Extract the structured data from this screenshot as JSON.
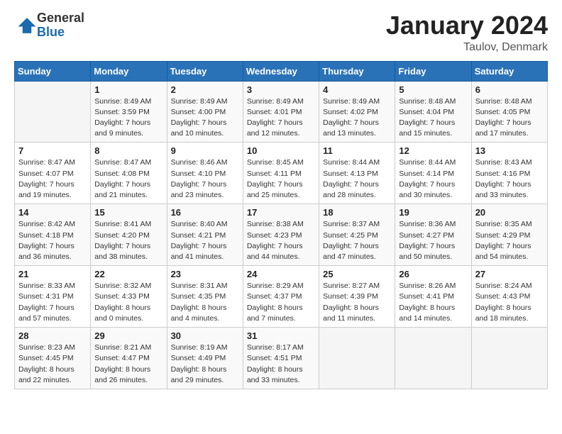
{
  "header": {
    "logo_general": "General",
    "logo_blue": "Blue",
    "title": "January 2024",
    "subtitle": "Taulov, Denmark"
  },
  "days_of_week": [
    "Sunday",
    "Monday",
    "Tuesday",
    "Wednesday",
    "Thursday",
    "Friday",
    "Saturday"
  ],
  "weeks": [
    [
      {
        "day": "",
        "info": ""
      },
      {
        "day": "1",
        "info": "Sunrise: 8:49 AM\nSunset: 3:59 PM\nDaylight: 7 hours\nand 9 minutes."
      },
      {
        "day": "2",
        "info": "Sunrise: 8:49 AM\nSunset: 4:00 PM\nDaylight: 7 hours\nand 10 minutes."
      },
      {
        "day": "3",
        "info": "Sunrise: 8:49 AM\nSunset: 4:01 PM\nDaylight: 7 hours\nand 12 minutes."
      },
      {
        "day": "4",
        "info": "Sunrise: 8:49 AM\nSunset: 4:02 PM\nDaylight: 7 hours\nand 13 minutes."
      },
      {
        "day": "5",
        "info": "Sunrise: 8:48 AM\nSunset: 4:04 PM\nDaylight: 7 hours\nand 15 minutes."
      },
      {
        "day": "6",
        "info": "Sunrise: 8:48 AM\nSunset: 4:05 PM\nDaylight: 7 hours\nand 17 minutes."
      }
    ],
    [
      {
        "day": "7",
        "info": "Sunrise: 8:47 AM\nSunset: 4:07 PM\nDaylight: 7 hours\nand 19 minutes."
      },
      {
        "day": "8",
        "info": "Sunrise: 8:47 AM\nSunset: 4:08 PM\nDaylight: 7 hours\nand 21 minutes."
      },
      {
        "day": "9",
        "info": "Sunrise: 8:46 AM\nSunset: 4:10 PM\nDaylight: 7 hours\nand 23 minutes."
      },
      {
        "day": "10",
        "info": "Sunrise: 8:45 AM\nSunset: 4:11 PM\nDaylight: 7 hours\nand 25 minutes."
      },
      {
        "day": "11",
        "info": "Sunrise: 8:44 AM\nSunset: 4:13 PM\nDaylight: 7 hours\nand 28 minutes."
      },
      {
        "day": "12",
        "info": "Sunrise: 8:44 AM\nSunset: 4:14 PM\nDaylight: 7 hours\nand 30 minutes."
      },
      {
        "day": "13",
        "info": "Sunrise: 8:43 AM\nSunset: 4:16 PM\nDaylight: 7 hours\nand 33 minutes."
      }
    ],
    [
      {
        "day": "14",
        "info": "Sunrise: 8:42 AM\nSunset: 4:18 PM\nDaylight: 7 hours\nand 36 minutes."
      },
      {
        "day": "15",
        "info": "Sunrise: 8:41 AM\nSunset: 4:20 PM\nDaylight: 7 hours\nand 38 minutes."
      },
      {
        "day": "16",
        "info": "Sunrise: 8:40 AM\nSunset: 4:21 PM\nDaylight: 7 hours\nand 41 minutes."
      },
      {
        "day": "17",
        "info": "Sunrise: 8:38 AM\nSunset: 4:23 PM\nDaylight: 7 hours\nand 44 minutes."
      },
      {
        "day": "18",
        "info": "Sunrise: 8:37 AM\nSunset: 4:25 PM\nDaylight: 7 hours\nand 47 minutes."
      },
      {
        "day": "19",
        "info": "Sunrise: 8:36 AM\nSunset: 4:27 PM\nDaylight: 7 hours\nand 50 minutes."
      },
      {
        "day": "20",
        "info": "Sunrise: 8:35 AM\nSunset: 4:29 PM\nDaylight: 7 hours\nand 54 minutes."
      }
    ],
    [
      {
        "day": "21",
        "info": "Sunrise: 8:33 AM\nSunset: 4:31 PM\nDaylight: 7 hours\nand 57 minutes."
      },
      {
        "day": "22",
        "info": "Sunrise: 8:32 AM\nSunset: 4:33 PM\nDaylight: 8 hours\nand 0 minutes."
      },
      {
        "day": "23",
        "info": "Sunrise: 8:31 AM\nSunset: 4:35 PM\nDaylight: 8 hours\nand 4 minutes."
      },
      {
        "day": "24",
        "info": "Sunrise: 8:29 AM\nSunset: 4:37 PM\nDaylight: 8 hours\nand 7 minutes."
      },
      {
        "day": "25",
        "info": "Sunrise: 8:27 AM\nSunset: 4:39 PM\nDaylight: 8 hours\nand 11 minutes."
      },
      {
        "day": "26",
        "info": "Sunrise: 8:26 AM\nSunset: 4:41 PM\nDaylight: 8 hours\nand 14 minutes."
      },
      {
        "day": "27",
        "info": "Sunrise: 8:24 AM\nSunset: 4:43 PM\nDaylight: 8 hours\nand 18 minutes."
      }
    ],
    [
      {
        "day": "28",
        "info": "Sunrise: 8:23 AM\nSunset: 4:45 PM\nDaylight: 8 hours\nand 22 minutes."
      },
      {
        "day": "29",
        "info": "Sunrise: 8:21 AM\nSunset: 4:47 PM\nDaylight: 8 hours\nand 26 minutes."
      },
      {
        "day": "30",
        "info": "Sunrise: 8:19 AM\nSunset: 4:49 PM\nDaylight: 8 hours\nand 29 minutes."
      },
      {
        "day": "31",
        "info": "Sunrise: 8:17 AM\nSunset: 4:51 PM\nDaylight: 8 hours\nand 33 minutes."
      },
      {
        "day": "",
        "info": ""
      },
      {
        "day": "",
        "info": ""
      },
      {
        "day": "",
        "info": ""
      }
    ]
  ]
}
